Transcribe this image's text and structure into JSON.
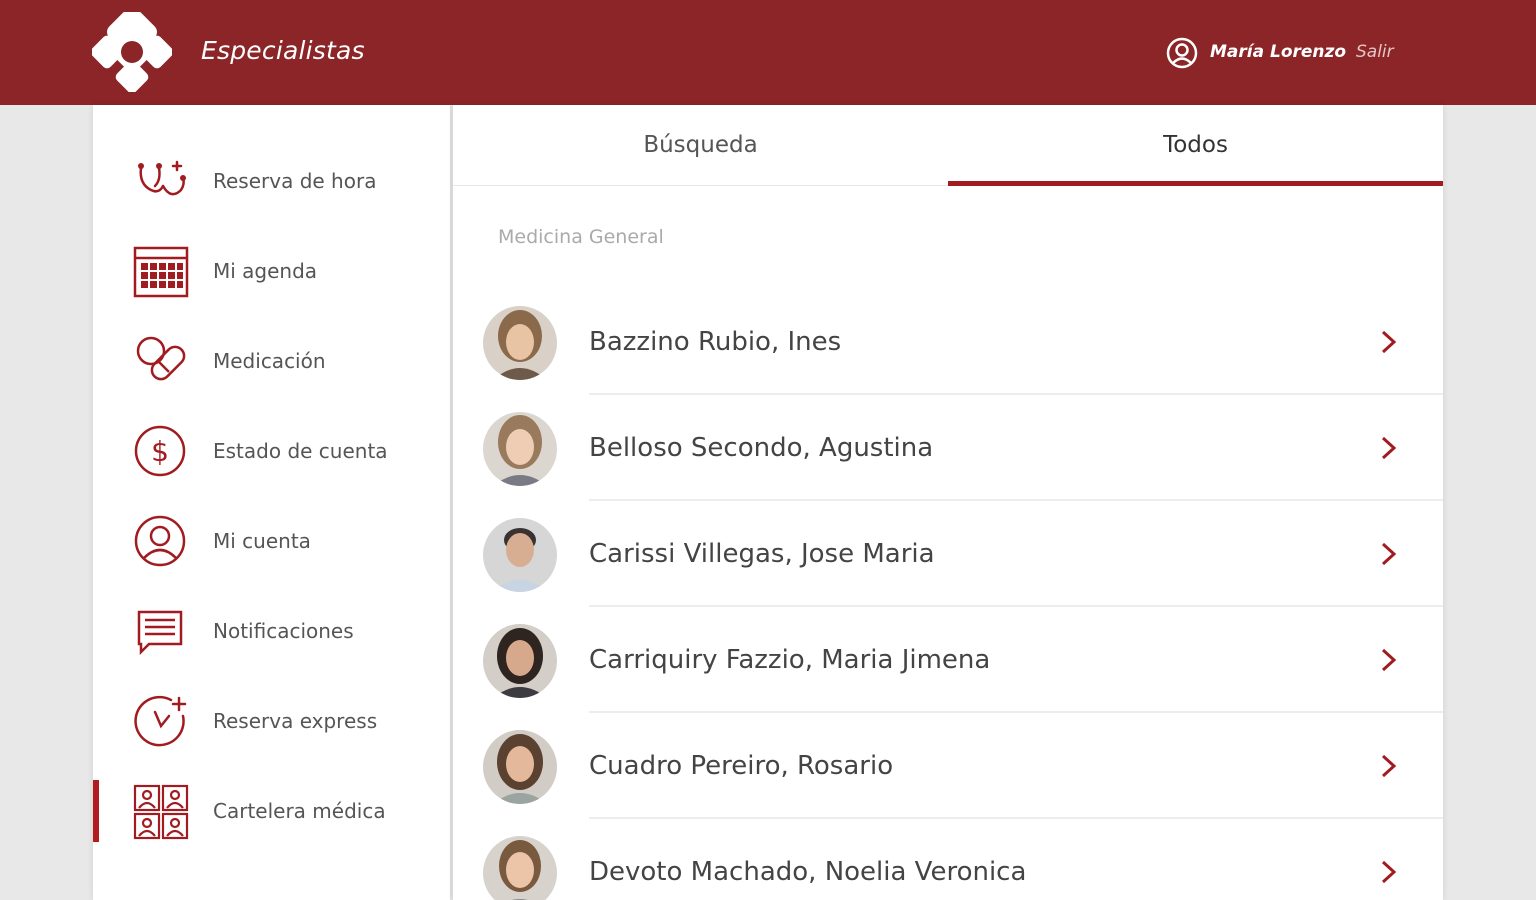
{
  "header": {
    "app_title": "Especialistas",
    "user_name": "María Lorenzo",
    "logout_label": "Salir"
  },
  "sidebar": {
    "items": [
      {
        "label": "Reserva de hora",
        "icon": "stethoscope-icon",
        "active": false
      },
      {
        "label": "Mi agenda",
        "icon": "calendar-icon",
        "active": false
      },
      {
        "label": "Medicación",
        "icon": "pills-icon",
        "active": false
      },
      {
        "label": "Estado de cuenta",
        "icon": "dollar-icon",
        "active": false
      },
      {
        "label": "Mi cuenta",
        "icon": "user-circle-icon",
        "active": false
      },
      {
        "label": "Notificaciones",
        "icon": "message-icon",
        "active": false
      },
      {
        "label": "Reserva express",
        "icon": "clock-plus-icon",
        "active": false
      },
      {
        "label": "Cartelera médica",
        "icon": "doctors-grid-icon",
        "active": true
      }
    ]
  },
  "tabs": [
    {
      "label": "Búsqueda",
      "active": false
    },
    {
      "label": "Todos",
      "active": true
    }
  ],
  "section_title": "Medicina General",
  "doctors": [
    {
      "name": "Bazzino Rubio, Ines"
    },
    {
      "name": "Belloso Secondo, Agustina"
    },
    {
      "name": "Carissi Villegas, Jose Maria"
    },
    {
      "name": "Carriquiry Fazzio, Maria Jimena"
    },
    {
      "name": "Cuadro Pereiro, Rosario"
    },
    {
      "name": "Devoto Machado, Noelia Veronica"
    }
  ],
  "colors": {
    "brand": "#8b2528",
    "accent": "#a11c20",
    "icon": "#a11c20"
  }
}
